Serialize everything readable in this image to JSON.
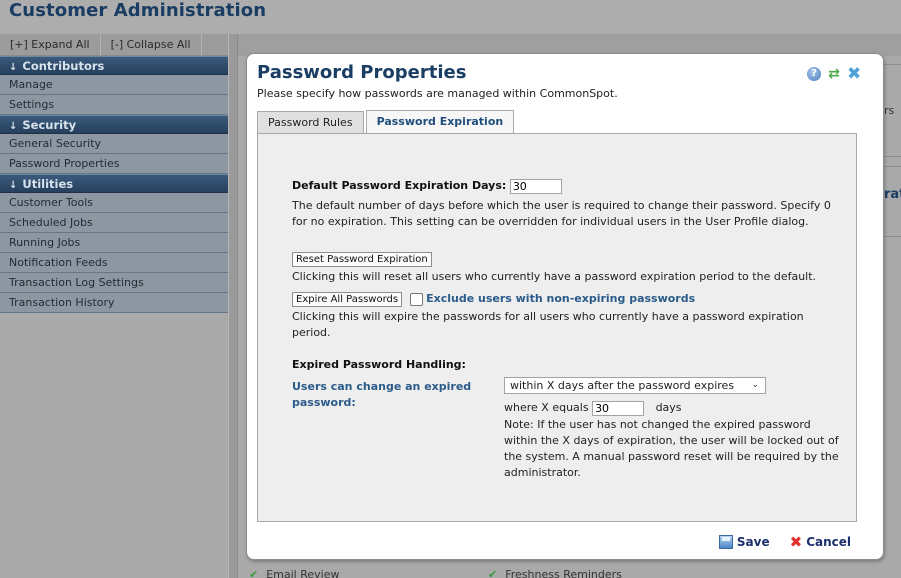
{
  "app": {
    "title": "Customer Administration"
  },
  "sidebar": {
    "expand_all": "[+] Expand All",
    "collapse_all": "[-] Collapse All",
    "sections": [
      {
        "label": "Contributors",
        "items": [
          "Manage",
          "Settings"
        ]
      },
      {
        "label": "Security",
        "items": [
          "General Security",
          "Password Properties"
        ]
      },
      {
        "label": "Utilities",
        "items": [
          "Customer Tools",
          "Scheduled Jobs",
          "Running Jobs",
          "Notification Feeds",
          "Transaction Log Settings",
          "Transaction History"
        ]
      }
    ],
    "arrow_glyph": "↓"
  },
  "background": {
    "right_text_1": "rs",
    "right_text_2": "rat",
    "bottom_items": [
      "Email Review",
      "Freshness Reminders"
    ],
    "check_glyph": "✔"
  },
  "dialog": {
    "title": "Password Properties",
    "subtitle": "Please specify how passwords are managed within CommonSpot.",
    "icons": {
      "help": "?",
      "refresh": "⇄",
      "close": "✖"
    },
    "tabs": [
      {
        "label": "Password Rules",
        "active": false
      },
      {
        "label": "Password Expiration",
        "active": true
      }
    ],
    "expiration": {
      "default_days_label": "Default Password Expiration Days:",
      "default_days_value": "30",
      "default_days_help": "The default number of days before which the user is required to change their password. Specify 0 for no expiration. This setting can be overridden for individual users in the User Profile dialog.",
      "reset_button": "Reset Password Expiration",
      "reset_help": "Clicking this will reset all users who currently have a password expiration period to the default.",
      "expire_button": "Expire All Passwords",
      "exclude_checkbox_label": "Exclude users with non-expiring passwords",
      "exclude_checked": false,
      "expire_help": "Clicking this will expire the passwords for all users who currently have a password expiration period.",
      "handling_heading": "Expired Password Handling:",
      "users_can_change_label": "Users can change an expired password:",
      "handling_select_value": "within X days after the password expires",
      "where_x_label": "where X equals",
      "x_value": "30",
      "x_unit": "days",
      "note": "Note: If the user has not changed the expired password within the X days of expiration, the user will be locked out of the system. A manual password reset will be required by the administrator."
    },
    "footer": {
      "save": "Save",
      "cancel": "Cancel"
    }
  }
}
